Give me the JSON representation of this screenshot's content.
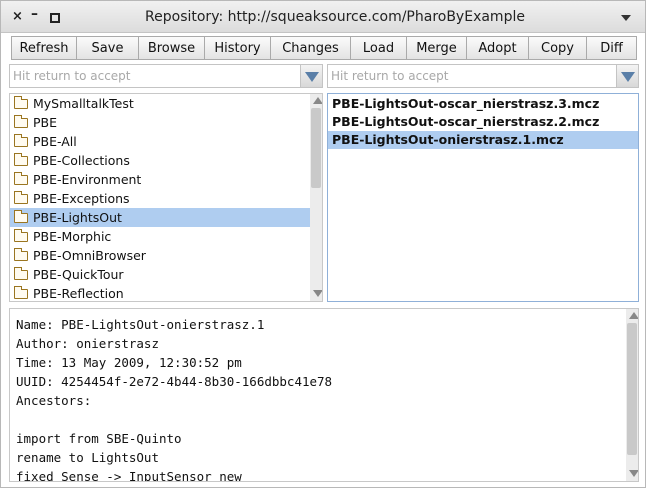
{
  "window": {
    "title": "Repository: http://squeaksource.com/PharoByExample",
    "close_glyph": "×",
    "minimize_glyph": "–"
  },
  "toolbar": {
    "buttons": [
      "Refresh",
      "Save",
      "Browse",
      "History",
      "Changes",
      "Load",
      "Merge",
      "Adopt",
      "Copy",
      "Diff"
    ]
  },
  "package_filter": {
    "placeholder": "Hit return to accept",
    "value": ""
  },
  "version_filter": {
    "placeholder": "Hit return to accept",
    "value": ""
  },
  "packages": {
    "items": [
      "MySmalltalkTest",
      "PBE",
      "PBE-All",
      "PBE-Collections",
      "PBE-Environment",
      "PBE-Exceptions",
      "PBE-LightsOut",
      "PBE-Morphic",
      "PBE-OmniBrowser",
      "PBE-QuickTour",
      "PBE-Reflection"
    ],
    "selected": "PBE-LightsOut"
  },
  "versions": {
    "items": [
      "PBE-LightsOut-oscar_nierstrasz.3.mcz",
      "PBE-LightsOut-oscar_nierstrasz.2.mcz",
      "PBE-LightsOut-onierstrasz.1.mcz"
    ],
    "selected": "PBE-LightsOut-onierstrasz.1.mcz"
  },
  "info": {
    "lines": [
      "Name: PBE-LightsOut-onierstrasz.1",
      "Author: onierstrasz",
      "Time: 13 May 2009, 12:30:52 pm",
      "UUID: 4254454f-2e72-4b44-8b30-166dbbc41e78",
      "Ancestors:",
      "",
      "import from SBE-Quinto",
      "rename to LightsOut",
      "fixed Sense -> InputSensor new"
    ]
  },
  "colors": {
    "selection": "#afcdf0",
    "dropdown_arrow": "#5a7fa8",
    "folder_outline": "#9a7520"
  },
  "icons": {
    "package": "folder-icon",
    "dropdown": "triangle-down-icon"
  }
}
